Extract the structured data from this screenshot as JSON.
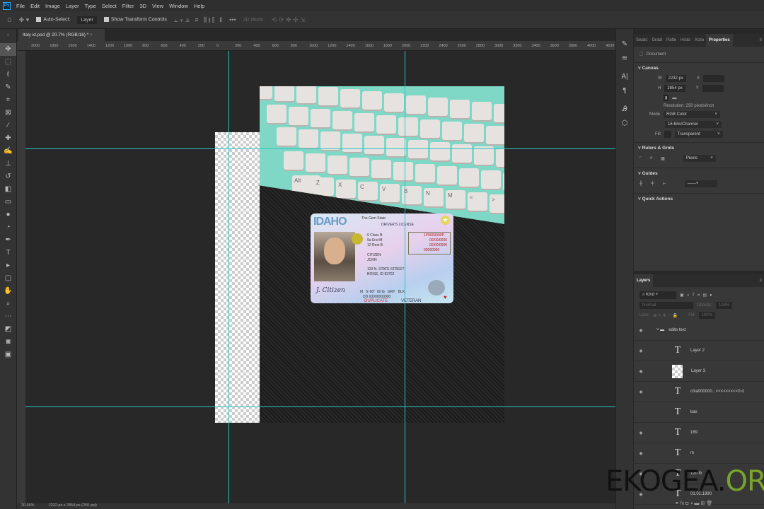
{
  "menu": [
    "File",
    "Edit",
    "Image",
    "Layer",
    "Type",
    "Select",
    "Filter",
    "3D",
    "View",
    "Window",
    "Help"
  ],
  "options": {
    "auto_select": "Auto-Select:",
    "auto_select_value": "Layer",
    "show_transform": "Show Transform Controls",
    "three_d_mode": "3D Mode:"
  },
  "document_tab": {
    "title": "Italy id.psd @ 20.7% (RGB/16) *"
  },
  "ruler_ticks": [
    "2000",
    "1800",
    "1600",
    "1400",
    "1200",
    "1000",
    "800",
    "600",
    "400",
    "200",
    "0",
    "200",
    "400",
    "600",
    "800",
    "1000",
    "1200",
    "1400",
    "1600",
    "1800",
    "2000",
    "2200",
    "2400",
    "2600",
    "2800",
    "3000",
    "3200",
    "3400",
    "3600",
    "3800",
    "4000",
    "4200"
  ],
  "keyboard_keys": [
    "Alt",
    "Z",
    "X",
    "C",
    "V",
    "B",
    "N",
    "M",
    "<",
    ">",
    "?"
  ],
  "card": {
    "state": "IDAHO",
    "subtitle": "The Gem State",
    "type": "DRIVER'S LICENSE",
    "num": "1P0000000P",
    "dob": "00/00/0000",
    "exp": "00/00/0000",
    "iss": "00000000",
    "name1": "CITIZEN",
    "name2": "JOHN",
    "addr1": "123 N. STATE STREET",
    "addr2": "BOISE, ID 83702",
    "class": "B",
    "end": "M",
    "rest": "B",
    "details": "M   5'-00\"  00 lb   GRY   BLK",
    "dd": "DD 00000000000",
    "duplicate": "DUPLICATE",
    "veteran": "VETERAN",
    "sig": "J. Citizen"
  },
  "properties": {
    "tabs": [
      "Swatc",
      "Gradi",
      "Patte",
      "Histo",
      "Actio",
      "Properties"
    ],
    "document": "Document",
    "canvas": "Canvas",
    "w_label": "W",
    "w": "2232 px",
    "h_label": "H",
    "h": "2854 px",
    "x_label": "X",
    "y_label": "Y",
    "resolution": "Resolution: 250 pixels/inch",
    "mode_label": "Mode",
    "mode": "RGB Color",
    "depth": "16 Bits/Channel",
    "fill_label": "Fill",
    "fill": "Transparent",
    "rulers": "Rulers & Grids",
    "units": "Pixels",
    "guides": "Guides",
    "quick": "Quick Actions"
  },
  "layers": {
    "title": "Layers",
    "filter": "Kind",
    "blend": "Normal",
    "opacity_label": "Opacity:",
    "opacity": "100%",
    "lock_label": "Lock:",
    "fill_label": "Fill:",
    "fill": "100%",
    "items": [
      {
        "name": "edite text",
        "kind": "folder"
      },
      {
        "name": "Layer 2",
        "kind": "text"
      },
      {
        "name": "Layer 3",
        "kind": "image"
      },
      {
        "name": "citia000000...<<<<<<<<<0 d",
        "kind": "text"
      },
      {
        "name": "bas",
        "kind": "text"
      },
      {
        "name": "169",
        "kind": "text"
      },
      {
        "name": "m",
        "kind": "text"
      },
      {
        "name": "120 lb",
        "kind": "text"
      },
      {
        "name": "01.01.1990",
        "kind": "text"
      }
    ]
  },
  "status": {
    "zoom": "20.66%",
    "doc": "2232 px x 2854 px (250 ppi)"
  },
  "watermark": {
    "a": "EKOGEA.",
    "b": "ORG"
  }
}
